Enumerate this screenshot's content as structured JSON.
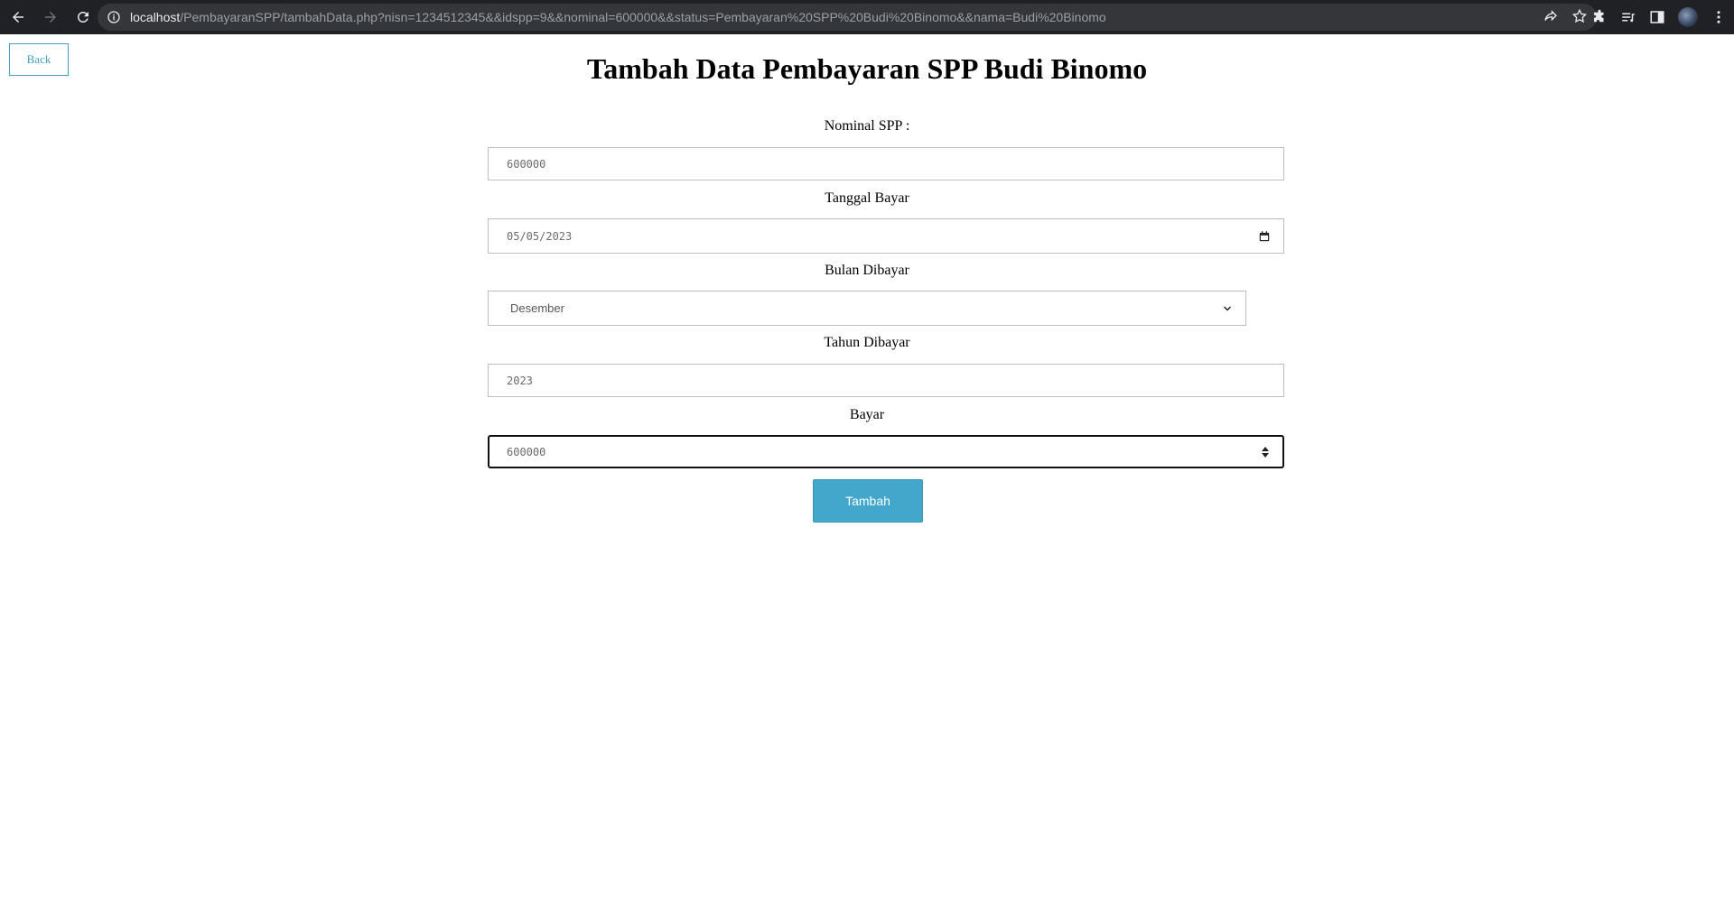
{
  "browser": {
    "url_host": "localhost",
    "url_path": "/PembayaranSPP/tambahData.php?nisn=1234512345&&idspp=9&&nominal=600000&&status=Pembayaran%20SPP%20Budi%20Binomo&&nama=Budi%20Binomo"
  },
  "page": {
    "back_label": "Back",
    "title": "Tambah Data Pembayaran SPP Budi Binomo",
    "submit_label": "Tambah"
  },
  "form": {
    "nominal": {
      "label": "Nominal SPP :",
      "value": "600000"
    },
    "tanggal": {
      "label": "Tanggal Bayar",
      "value": "05/05/2023"
    },
    "bulan": {
      "label": "Bulan Dibayar",
      "value": "Desember"
    },
    "tahun": {
      "label": "Tahun Dibayar",
      "value": "2023"
    },
    "bayar": {
      "label": "Bayar",
      "value": "600000"
    }
  },
  "colors": {
    "accent": "#43a7cb",
    "chrome_bg": "#202124"
  }
}
